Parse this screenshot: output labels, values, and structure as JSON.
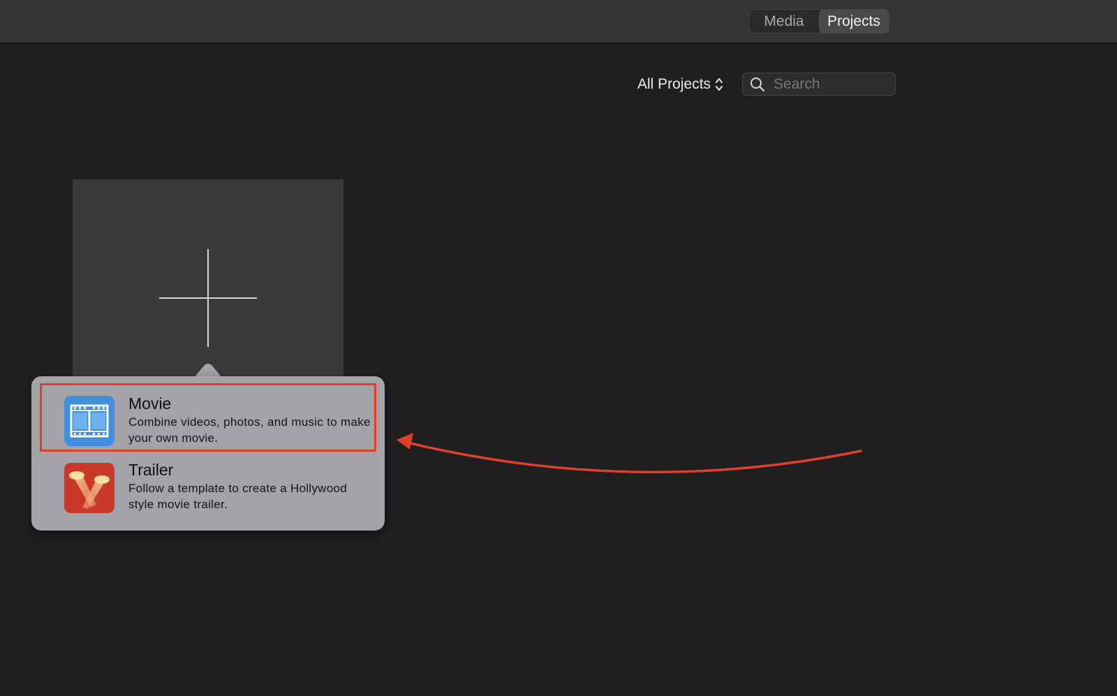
{
  "toolbar": {
    "tabs": [
      {
        "label": "Media",
        "active": false
      },
      {
        "label": "Projects",
        "active": true
      }
    ]
  },
  "browser": {
    "filter_label": "All Projects",
    "search_placeholder": "Search",
    "search_value": ""
  },
  "new_project_popover": {
    "options": [
      {
        "title": "Movie",
        "description": "Combine videos, photos, and music to make your own movie.",
        "icon": "film-strip-icon",
        "icon_color": "#3f8fdc",
        "highlighted": true
      },
      {
        "title": "Trailer",
        "description": "Follow a template to create a Hollywood style movie trailer.",
        "icon": "spotlights-icon",
        "icon_color": "#c9392a",
        "highlighted": false
      }
    ]
  },
  "colors": {
    "background": "#1f1f1f",
    "toolbar": "#343434",
    "tile": "#3a3a3a",
    "popover": "#a4a3aa",
    "highlight": "#e0402b",
    "annotation_arrow": "#e0402b"
  }
}
